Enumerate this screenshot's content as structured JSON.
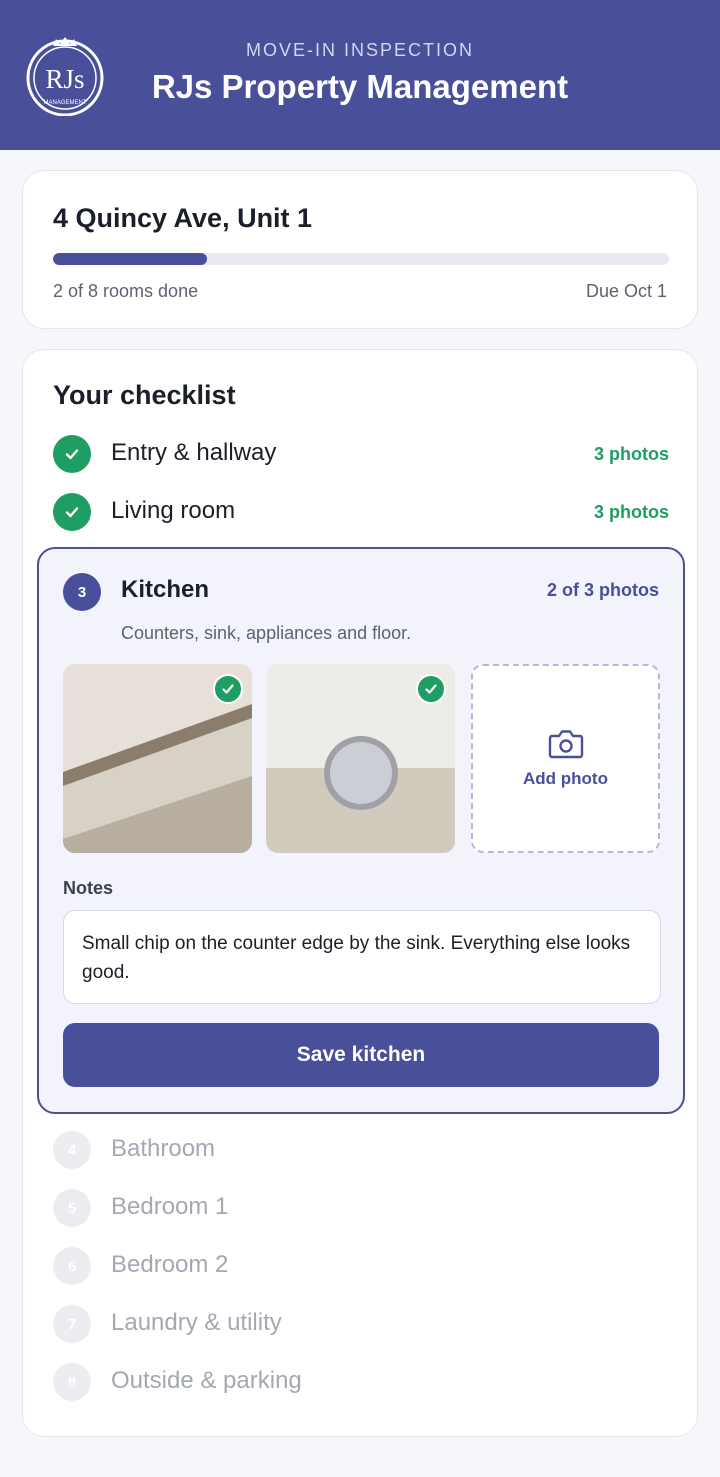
{
  "header": {
    "eyebrow": "MOVE-IN INSPECTION",
    "title": "RJs Property Management",
    "logo_text": "RJs",
    "logo_subtext": "MANAGEMENT"
  },
  "property": {
    "address": "4 Quincy Ave, Unit 1",
    "progress_fraction": 0.25,
    "progress_text": "2 of 8 rooms done",
    "due_text": "Due Oct 1"
  },
  "checklist": {
    "title": "Your checklist",
    "completed": [
      {
        "label": "Entry & hallway",
        "meta": "3 photos"
      },
      {
        "label": "Living room",
        "meta": "3 photos"
      }
    ],
    "active": {
      "number": "3",
      "label": "Kitchen",
      "meta": "2 of 3 photos",
      "description": "Counters, sink, appliances and floor.",
      "add_photo_label": "Add photo",
      "notes_label": "Notes",
      "notes_value": "Small chip on the counter edge by the sink. Everything else looks good.",
      "save_label": "Save kitchen"
    },
    "pending": [
      {
        "number": "4",
        "label": "Bathroom"
      },
      {
        "number": "5",
        "label": "Bedroom 1"
      },
      {
        "number": "6",
        "label": "Bedroom 2"
      },
      {
        "number": "7",
        "label": "Laundry & utility"
      },
      {
        "number": "8",
        "label": "Outside & parking"
      }
    ]
  },
  "colors": {
    "brand": "#4a4f9a",
    "success": "#1f9e63",
    "pending_circle": "#ecedf1",
    "pending_text": "#a4a8b3"
  },
  "icons": {
    "done": "check-icon",
    "add_photo": "camera-icon",
    "photo_uploaded": "check-badge-icon"
  }
}
